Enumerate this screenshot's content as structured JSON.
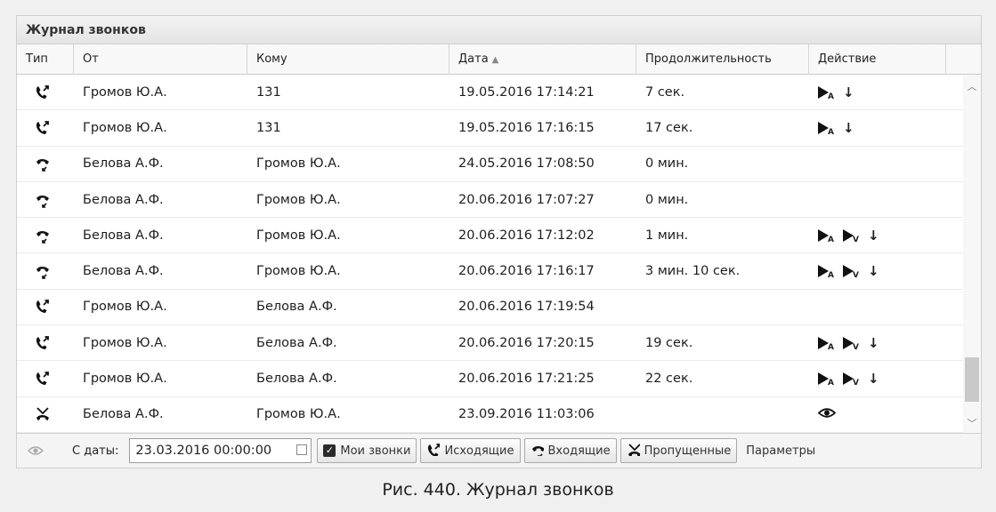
{
  "panel": {
    "title": "Журнал звонков"
  },
  "columns": {
    "type": "Тип",
    "from": "От",
    "to": "Кому",
    "date": "Дата",
    "date_sort": "▲",
    "duration": "Продолжительность",
    "action": "Действие"
  },
  "rows": [
    {
      "type": "outgoing-call-icon",
      "from": "Громов Ю.А.",
      "to": "131",
      "date": "19.05.2016 17:14:21",
      "duration": "7 сек.",
      "actions": [
        "play-a",
        "download"
      ]
    },
    {
      "type": "outgoing-call-icon",
      "from": "Громов Ю.А.",
      "to": "131",
      "date": "19.05.2016 17:16:15",
      "duration": "17 сек.",
      "actions": [
        "play-a",
        "download"
      ]
    },
    {
      "type": "incoming-call-icon",
      "from": "Белова А.Ф.",
      "to": "Громов Ю.А.",
      "date": "24.05.2016 17:08:50",
      "duration": "0 мин.",
      "actions": []
    },
    {
      "type": "incoming-call-icon",
      "from": "Белова А.Ф.",
      "to": "Громов Ю.А.",
      "date": "20.06.2016 17:07:27",
      "duration": "0 мин.",
      "actions": []
    },
    {
      "type": "incoming-call-icon",
      "from": "Белова А.Ф.",
      "to": "Громов Ю.А.",
      "date": "20.06.2016 17:12:02",
      "duration": "1 мин.",
      "actions": [
        "play-a",
        "play-v",
        "download"
      ]
    },
    {
      "type": "incoming-call-icon",
      "from": "Белова А.Ф.",
      "to": "Громов Ю.А.",
      "date": "20.06.2016 17:16:17",
      "duration": "3 мин. 10 сек.",
      "actions": [
        "play-a",
        "play-v",
        "download"
      ]
    },
    {
      "type": "outgoing-call-icon",
      "from": "Громов Ю.А.",
      "to": "Белова А.Ф.",
      "date": "20.06.2016 17:19:54",
      "duration": "",
      "actions": []
    },
    {
      "type": "outgoing-call-icon",
      "from": "Громов Ю.А.",
      "to": "Белова А.Ф.",
      "date": "20.06.2016 17:20:15",
      "duration": "19 сек.",
      "actions": [
        "play-a",
        "play-v",
        "download"
      ]
    },
    {
      "type": "outgoing-call-icon",
      "from": "Громов Ю.А.",
      "to": "Белова А.Ф.",
      "date": "20.06.2016 17:21:25",
      "duration": "22 сек.",
      "actions": [
        "play-a",
        "play-v",
        "download"
      ]
    },
    {
      "type": "missed-call-icon",
      "from": "Белова А.Ф.",
      "to": "Громов Ю.А.",
      "date": "23.09.2016 11:03:06",
      "duration": "",
      "actions": [
        "view"
      ]
    }
  ],
  "action_labels": {
    "play_a": "A",
    "play_v": "V",
    "download": "🠗"
  },
  "toolbar": {
    "date_label": "С даты:",
    "date_value": "23.03.2016 00:00:00",
    "my_calls": "Мои звонки",
    "outgoing": "Исходящие",
    "incoming": "Входящие",
    "missed": "Пропущенные",
    "params": "Параметры"
  },
  "caption": "Рис. 440. Журнал звонков"
}
